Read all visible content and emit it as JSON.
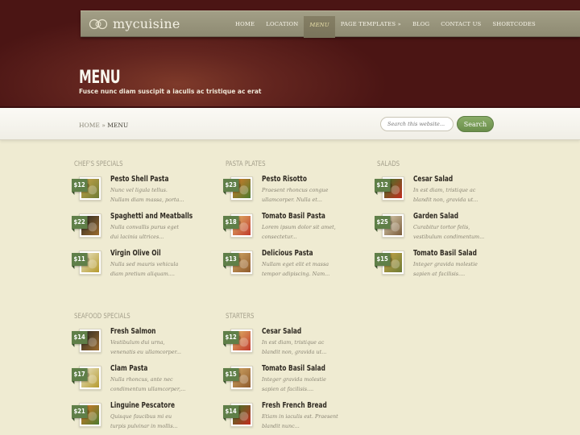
{
  "site": {
    "logo_text": "mycuisine"
  },
  "nav": {
    "items": [
      {
        "label": "Home",
        "active": false
      },
      {
        "label": "Location",
        "active": false
      },
      {
        "label": "Menu",
        "active": true
      },
      {
        "label": "Page Templates »",
        "active": false
      },
      {
        "label": "Blog",
        "active": false
      },
      {
        "label": "Contact Us",
        "active": false
      },
      {
        "label": "Shortcodes",
        "active": false
      }
    ]
  },
  "page": {
    "title": "MENU",
    "subtitle": "Fusce nunc diam suscipit a iaculis ac tristique ac erat"
  },
  "breadcrumb": {
    "home": "HOME",
    "separator": "»",
    "current": "MENU"
  },
  "search": {
    "placeholder": "Search this website...",
    "button_label": "Search"
  },
  "colors": {
    "price_badge": "#5f7f48",
    "search_button": "#7a9d59",
    "header": "#5a1e1c",
    "background": "#efebd2"
  },
  "sections": [
    {
      "title": "Chef's Specials",
      "items": [
        {
          "name": "Pesto Shell Pasta",
          "price": "$12",
          "desc": "Nunc vel ligula tellus. Nullam diam massa, porta...",
          "icon": "pasta-shells-image"
        },
        {
          "name": "Spaghetti and Meatballs",
          "price": "$22",
          "desc": "Nulla convallis purus eget dui lacinia ultrices...",
          "icon": "spaghetti-image"
        },
        {
          "name": "Virgin Olive Oil",
          "price": "$11",
          "desc": "Nulla sed mauris vehicula diam pretium aliquam....",
          "icon": "olive-oil-image"
        }
      ]
    },
    {
      "title": "Pasta Plates",
      "items": [
        {
          "name": "Pesto Risotto",
          "price": "$23",
          "desc": "Praesent rhoncus congue ullamcorper. Nulla et...",
          "icon": "risotto-image"
        },
        {
          "name": "Tomato Basil Pasta",
          "price": "$18",
          "desc": "Lorem ipsum dolor sit amet, consectetur...",
          "icon": "tomato-pasta-image"
        },
        {
          "name": "Delicious Pasta",
          "price": "$13",
          "desc": "Nullam eget elit et massa tempor adipiscing. Nam...",
          "icon": "pasta-plate-image"
        }
      ]
    },
    {
      "title": "Salads",
      "items": [
        {
          "name": "Cesar Salad",
          "price": "$12",
          "desc": "In est diam, tristique ac blandit non, gravida ut...",
          "icon": "salad-image"
        },
        {
          "name": "Garden Salad",
          "price": "$25",
          "desc": "Curabitur tortor felis, vestibulum condimentum...",
          "icon": "garden-salad-image"
        },
        {
          "name": "Tomato Basil Salad",
          "price": "$15",
          "desc": "Integer gravida molestie sapien at facilisis....",
          "icon": "tomato-salad-image"
        }
      ]
    },
    {
      "title": "Seafood Specials",
      "items": [
        {
          "name": "Fresh Salmon",
          "price": "$14",
          "desc": "Vestibulum dui urna, venenatis eu ullamcorper...",
          "icon": "salmon-image"
        },
        {
          "name": "Clam Pasta",
          "price": "$17",
          "desc": "Nulla rhoncus, ante nec condimentum ullamcorper,...",
          "icon": "clam-pasta-image"
        },
        {
          "name": "Linguine Pescatore",
          "price": "$21",
          "desc": "Quisque faucibus mi eu turpis pulvinar in mollis...",
          "icon": "linguine-image"
        }
      ]
    },
    {
      "title": "Starters",
      "items": [
        {
          "name": "Cesar Salad",
          "price": "$12",
          "desc": "In est diam, tristique ac blandit non, gravida ut...",
          "icon": "salad-image"
        },
        {
          "name": "Tomato Basil Salad",
          "price": "$15",
          "desc": "Integer gravida molestie sapien at facilisis....",
          "icon": "tomato-salad-image"
        },
        {
          "name": "Fresh French Bread",
          "price": "$14",
          "desc": "Etiam in iaculis est. Praesent blandit nunc...",
          "icon": "bread-image"
        }
      ]
    }
  ]
}
